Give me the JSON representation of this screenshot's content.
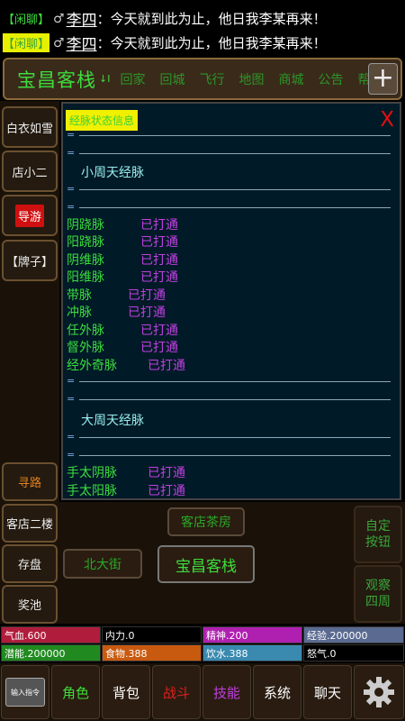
{
  "chat": [
    {
      "tag": "【闲聊】",
      "sex": "♂",
      "name": "李四",
      "message": "：今天就到此为止，他日我李某再来！"
    },
    {
      "tag": "【闲聊】",
      "sex": "♂",
      "name": "李四",
      "message": "：今天就到此为止，他日我李某再来！"
    }
  ],
  "topbar": {
    "location": "宝昌客栈",
    "location_icon": "↓I",
    "nav": [
      "回家",
      "回城",
      "飞行",
      "地图",
      "商城",
      "公告",
      "帮会"
    ],
    "plus": "+"
  },
  "sidebar": [
    {
      "label": "白衣如雪"
    },
    {
      "label": "店小二"
    },
    {
      "label": "导游"
    },
    {
      "label": "【牌子】"
    },
    {
      "label": "寻路"
    },
    {
      "label": "客店二楼"
    },
    {
      "label": "存盘"
    },
    {
      "label": "奖池"
    }
  ],
  "panel": {
    "header": "经脉状态信息",
    "close": "X",
    "sep_mark": "=",
    "section1": "小周天经脉",
    "section2": "大周天经脉",
    "meridians_small": [
      {
        "name": "阴跷脉",
        "status": "已打通"
      },
      {
        "name": "阳跷脉",
        "status": "已打通"
      },
      {
        "name": "阴维脉",
        "status": "已打通"
      },
      {
        "name": "阳维脉",
        "status": "已打通"
      },
      {
        "name": "带脉",
        "status": "已打通"
      },
      {
        "name": "冲脉",
        "status": "已打通"
      },
      {
        "name": "任外脉",
        "status": "已打通"
      },
      {
        "name": "督外脉",
        "status": "已打通"
      },
      {
        "name": "经外奇脉",
        "status": "已打通"
      }
    ],
    "meridians_big": [
      {
        "name": "手太阴脉",
        "status": "已打通"
      },
      {
        "name": "手太阳脉",
        "status": "已打通"
      }
    ]
  },
  "map": {
    "north": "客店茶房",
    "west": "北大街",
    "current": "宝昌客栈"
  },
  "right_buttons": [
    "自定\n按钮",
    "观察\n四周"
  ],
  "stats": [
    {
      "label": "气血.600",
      "color": "#b01c3c"
    },
    {
      "label": "内力.0",
      "color": "#000000"
    },
    {
      "label": "精神.200",
      "color": "#b020b0"
    },
    {
      "label": "经验.200000",
      "color": "#5a6a90"
    },
    {
      "label": "潜能.200000",
      "color": "#208a20"
    },
    {
      "label": "食物.388",
      "color": "#c85a10"
    },
    {
      "label": "饮水.388",
      "color": "#3a8ab0"
    },
    {
      "label": "怒气.0",
      "color": "#000000"
    }
  ],
  "bottom": {
    "input": "输入指令",
    "buttons": [
      {
        "label": "角色",
        "color": "#3ddc3d"
      },
      {
        "label": "背包",
        "color": "#ffffff"
      },
      {
        "label": "战斗",
        "color": "#e02020"
      },
      {
        "label": "技能",
        "color": "#c040e0"
      },
      {
        "label": "系统",
        "color": "#ffffff"
      },
      {
        "label": "聊天",
        "color": "#ffffff"
      }
    ],
    "settings_icon": "gear-icon"
  }
}
